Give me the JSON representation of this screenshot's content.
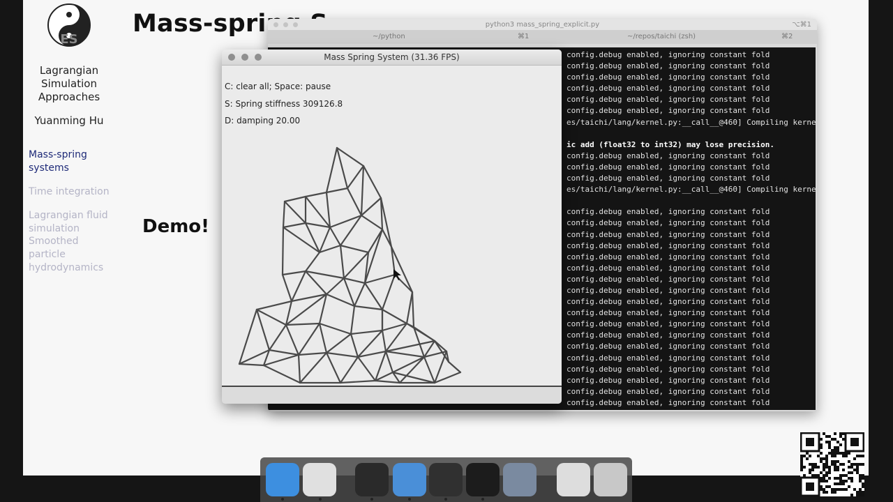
{
  "slide": {
    "title": "Mass-spring S",
    "talk_title_lines": [
      "Lagrangian",
      "Simulation",
      "Approaches"
    ],
    "author": "Yuanming Hu",
    "toc": [
      {
        "text": "Mass-spring systems",
        "active": true
      },
      {
        "text": "Time integration",
        "active": false
      },
      {
        "text": "Lagrangian fluid simulation",
        "active": false
      },
      {
        "text": "Smoothed particle hydrodynamics",
        "active": false
      }
    ],
    "demo": "Demo!",
    "logo_text": "ES"
  },
  "terminal_window": {
    "title": "python3 mass_spring_explicit.py",
    "shortcut": "⌥⌘1",
    "tabs": [
      {
        "label": "~/python",
        "shortcut": "⌘1"
      },
      {
        "label": "~/repos/taichi (zsh)",
        "shortcut": "⌘2"
      }
    ],
    "lines": [
      {
        "text": "config.debug enabled, ignoring constant fold"
      },
      {
        "text": "config.debug enabled, ignoring constant fold"
      },
      {
        "text": "config.debug enabled, ignoring constant fold"
      },
      {
        "text": "config.debug enabled, ignoring constant fold"
      },
      {
        "text": "config.debug enabled, ignoring constant fold"
      },
      {
        "text": "config.debug enabled, ignoring constant fold"
      },
      {
        "text": "es/taichi/lang/kernel.py:__call__@460] Compiling kerne"
      },
      {
        "text": ""
      },
      {
        "text": "ic add (float32 to int32) may lose precision.",
        "bold": true
      },
      {
        "text": "config.debug enabled, ignoring constant fold"
      },
      {
        "text": "config.debug enabled, ignoring constant fold"
      },
      {
        "text": "config.debug enabled, ignoring constant fold"
      },
      {
        "text": "es/taichi/lang/kernel.py:__call__@460] Compiling kerne"
      },
      {
        "text": ""
      },
      {
        "text": "config.debug enabled, ignoring constant fold"
      },
      {
        "text": "config.debug enabled, ignoring constant fold"
      },
      {
        "text": "config.debug enabled, ignoring constant fold"
      },
      {
        "text": "config.debug enabled, ignoring constant fold"
      },
      {
        "text": "config.debug enabled, ignoring constant fold"
      },
      {
        "text": "config.debug enabled, ignoring constant fold"
      },
      {
        "text": "config.debug enabled, ignoring constant fold"
      },
      {
        "text": "config.debug enabled, ignoring constant fold"
      },
      {
        "text": "config.debug enabled, ignoring constant fold"
      },
      {
        "text": "config.debug enabled, ignoring constant fold"
      },
      {
        "text": "config.debug enabled, ignoring constant fold"
      },
      {
        "text": "config.debug enabled, ignoring constant fold"
      },
      {
        "text": "config.debug enabled, ignoring constant fold"
      },
      {
        "text": "config.debug enabled, ignoring constant fold"
      },
      {
        "text": "config.debug enabled, ignoring constant fold"
      },
      {
        "text": "config.debug enabled, ignoring constant fold"
      },
      {
        "text": "config.debug enabled, ignoring constant fold"
      },
      {
        "text": "config.debug enabled, ignoring constant fold"
      }
    ]
  },
  "gui_window": {
    "title": "Mass Spring System (31.36 FPS)",
    "help": "C: clear all; Space: pause",
    "stiffness": "S: Spring stiffness 309126.8",
    "damping": "D: damping 20.00",
    "colors": {
      "springs": "#4a4a4a",
      "ground": "#444444",
      "canvas": "#ebebeb"
    }
  },
  "dock": {
    "items": [
      {
        "name": "finder-icon",
        "color": "#3d8fe0"
      },
      {
        "name": "chrome-icon",
        "color": "#e0e0e0"
      },
      {
        "name": "terminal-icon",
        "color": "#2a2a2a"
      },
      {
        "name": "keynote-icon",
        "color": "#4a8fd8"
      },
      {
        "name": "obs-icon",
        "color": "#303030"
      },
      {
        "name": "latex-icon",
        "color": "#1c1c1c"
      },
      {
        "name": "rocket-icon",
        "color": "#7a8aa0"
      },
      {
        "name": "qr-app-icon",
        "color": "#dddddd"
      },
      {
        "name": "trash-icon",
        "color": "#c8c8c8"
      }
    ]
  }
}
